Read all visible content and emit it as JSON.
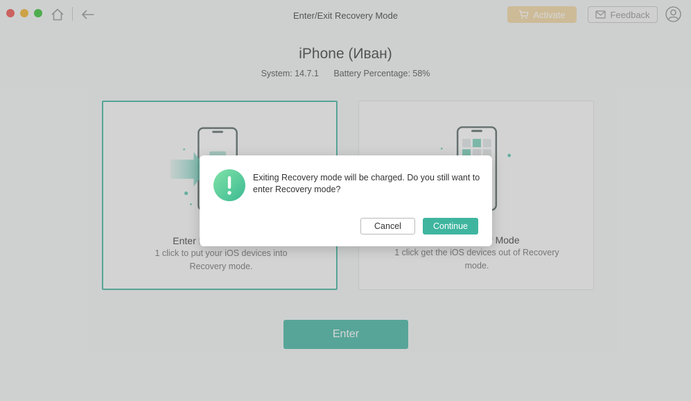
{
  "window": {
    "title": "Enter/Exit Recovery Mode"
  },
  "toolbar": {
    "activate_label": "Activate",
    "feedback_label": "Feedback"
  },
  "device": {
    "name": "iPhone (Иван)",
    "system": "System: 14.7.1",
    "battery": "Battery Percentage: 58%"
  },
  "cards": {
    "enter": {
      "title": "Enter Recovery Mode",
      "description": "1 click to put your iOS devices into Recovery mode."
    },
    "exit": {
      "title": "Exit Recovery Mode",
      "description": "1 click get the iOS devices out of Recovery mode."
    }
  },
  "main": {
    "enter_label": "Enter"
  },
  "dialog": {
    "message": "Exiting Recovery mode will be charged. Do you still want to enter Recovery mode?",
    "cancel_label": "Cancel",
    "continue_label": "Continue"
  },
  "colors": {
    "accent": "#49b9a6",
    "activate": "#f3d9a7",
    "warning_icon": "#4cc596"
  }
}
